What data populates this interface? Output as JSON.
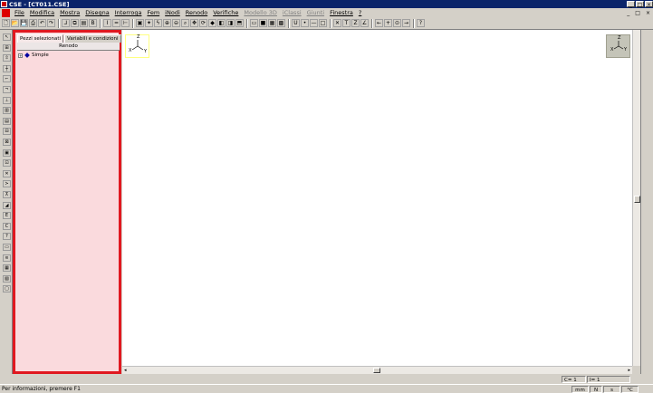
{
  "window": {
    "title": "CSE - [CT011.CSE]",
    "controls": [
      "_",
      "□",
      "×"
    ]
  },
  "menubar": {
    "items": [
      {
        "label": "File",
        "enabled": true
      },
      {
        "label": "Modifica",
        "enabled": true
      },
      {
        "label": "Mostra",
        "enabled": true
      },
      {
        "label": "Disegna",
        "enabled": true
      },
      {
        "label": "Interroga",
        "enabled": true
      },
      {
        "label": "Fem",
        "enabled": true
      },
      {
        "label": "iNodi",
        "enabled": true
      },
      {
        "label": "Renodo",
        "enabled": true
      },
      {
        "label": "Verifiche",
        "enabled": true
      },
      {
        "label": "Modello 3D",
        "enabled": false
      },
      {
        "label": "iClassi",
        "enabled": false
      },
      {
        "label": "Giunti",
        "enabled": false
      },
      {
        "label": "Finestra",
        "enabled": true
      },
      {
        "label": "?",
        "enabled": true
      }
    ],
    "child_controls": [
      "_",
      "□",
      "×"
    ]
  },
  "toolbar": {
    "buttons": [
      {
        "name": "new-file-icon",
        "glyph": "🗋"
      },
      {
        "name": "open-file-icon",
        "glyph": "📂"
      },
      {
        "name": "save-icon",
        "glyph": "💾"
      },
      {
        "name": "print-icon",
        "glyph": "⎙"
      },
      {
        "name": "undo-icon",
        "glyph": "↶"
      },
      {
        "name": "redo-icon",
        "glyph": "↷"
      },
      {
        "name": "sep"
      },
      {
        "name": "node-icon",
        "glyph": "⅃"
      },
      {
        "name": "copy-icon",
        "glyph": "⧉"
      },
      {
        "name": "page-icon",
        "glyph": "▤"
      },
      {
        "name": "bold-icon",
        "glyph": "B"
      },
      {
        "name": "sep"
      },
      {
        "name": "column-icon",
        "glyph": "I"
      },
      {
        "name": "beam-icon",
        "glyph": "═"
      },
      {
        "name": "brace-icon",
        "glyph": "⊢"
      },
      {
        "name": "sep"
      },
      {
        "name": "screen-icon",
        "glyph": "▣"
      },
      {
        "name": "wand-icon",
        "glyph": "✦"
      },
      {
        "name": "bolt-icon",
        "glyph": "ϟ"
      },
      {
        "name": "zoom-in-icon",
        "glyph": "⊕"
      },
      {
        "name": "zoom-out-icon",
        "glyph": "⊖"
      },
      {
        "name": "zoom-window-icon",
        "glyph": "⌕"
      },
      {
        "name": "pan-icon",
        "glyph": "✥"
      },
      {
        "name": "rotate-icon",
        "glyph": "⟳"
      },
      {
        "name": "view-3d-icon",
        "glyph": "◆"
      },
      {
        "name": "view-front-icon",
        "glyph": "◧"
      },
      {
        "name": "view-side-icon",
        "glyph": "◨"
      },
      {
        "name": "view-top-icon",
        "glyph": "⬒"
      },
      {
        "name": "sep"
      },
      {
        "name": "render-icon",
        "glyph": "▭"
      },
      {
        "name": "solid-icon",
        "glyph": "■"
      },
      {
        "name": "wire-icon",
        "glyph": "▦"
      },
      {
        "name": "mesh-icon",
        "glyph": "▩"
      },
      {
        "name": "sep"
      },
      {
        "name": "u-icon",
        "glyph": "U"
      },
      {
        "name": "point-icon",
        "glyph": "•"
      },
      {
        "name": "line-icon",
        "glyph": "—"
      },
      {
        "name": "rect-icon",
        "glyph": "□"
      },
      {
        "name": "sep"
      },
      {
        "name": "delete-icon",
        "glyph": "✕"
      },
      {
        "name": "t-icon",
        "glyph": "T"
      },
      {
        "name": "z-icon",
        "glyph": "Z"
      },
      {
        "name": "angle-icon",
        "glyph": "∠"
      },
      {
        "name": "sep"
      },
      {
        "name": "arrow-left-icon",
        "glyph": "←"
      },
      {
        "name": "plus-icon",
        "glyph": "+"
      },
      {
        "name": "target-icon",
        "glyph": "⊙"
      },
      {
        "name": "arrow-right-icon",
        "glyph": "→"
      },
      {
        "name": "sep"
      },
      {
        "name": "help-icon",
        "glyph": "?"
      }
    ]
  },
  "left_tools": [
    {
      "name": "select-icon",
      "glyph": "↖"
    },
    {
      "name": "node-add-icon",
      "glyph": "⊞"
    },
    {
      "name": "node-move-icon",
      "glyph": "⇳"
    },
    {
      "name": "beam-add-icon",
      "glyph": "┼"
    },
    {
      "name": "tool-5-icon",
      "glyph": "⌐"
    },
    {
      "name": "tool-6-icon",
      "glyph": "¬"
    },
    {
      "name": "tool-7-icon",
      "glyph": "⊥"
    },
    {
      "name": "tool-8-icon",
      "glyph": "▥"
    },
    {
      "name": "tool-9-icon",
      "glyph": "▤"
    },
    {
      "name": "tool-10-icon",
      "glyph": "⊟"
    },
    {
      "name": "tool-11-icon",
      "glyph": "⊠"
    },
    {
      "name": "tool-12-icon",
      "glyph": "▣"
    },
    {
      "name": "tool-13-icon",
      "glyph": "⊡"
    },
    {
      "name": "tool-14-icon",
      "glyph": "✕"
    },
    {
      "name": "tool-15-icon",
      "glyph": "≻"
    },
    {
      "name": "tool-16-icon",
      "glyph": "⊼"
    },
    {
      "name": "tool-17-icon",
      "glyph": "◢"
    },
    {
      "name": "tool-18-icon",
      "glyph": "E"
    },
    {
      "name": "tool-19-icon",
      "glyph": "C"
    },
    {
      "name": "tool-20-icon",
      "glyph": "?"
    },
    {
      "name": "tool-21-icon",
      "glyph": "▭"
    },
    {
      "name": "tool-22-icon",
      "glyph": "≋"
    },
    {
      "name": "tool-23-icon",
      "glyph": "▦"
    },
    {
      "name": "tool-24-icon",
      "glyph": "▧"
    },
    {
      "name": "tool-25-icon",
      "glyph": "▢"
    }
  ],
  "panel": {
    "tabs": [
      "Pezzi selezionati",
      "Variabili e condizioni"
    ],
    "active_tab": 0,
    "subtab": "Renodo",
    "tree_items": [
      {
        "label": "Simple",
        "expander": "+"
      }
    ]
  },
  "viewport": {
    "axes_left": {
      "z": "Z",
      "x": "X",
      "y": "Y"
    },
    "axes_right": {
      "z": "Z",
      "x": "X",
      "y": "Y"
    }
  },
  "coords": {
    "c": "C= 1",
    "i": "I= 1"
  },
  "statusbar": {
    "message": "Per informazioni, premere F1",
    "cells": [
      "mm",
      "N",
      "s",
      "°C"
    ]
  }
}
